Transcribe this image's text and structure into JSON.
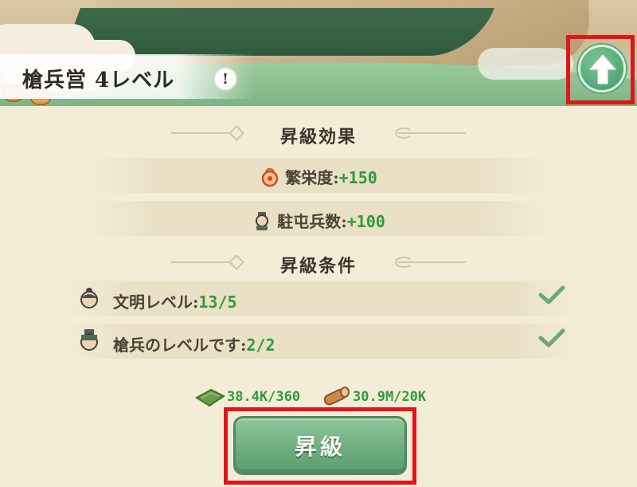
{
  "header": {
    "title": "槍兵営 4レベル",
    "info_glyph": "!"
  },
  "upgrade_badge": {
    "icon": "arrow-up-icon"
  },
  "effects": {
    "title": "昇級効果",
    "items": [
      {
        "icon": "prosperity-icon",
        "label": "繁栄度:",
        "value": "+150"
      },
      {
        "icon": "soldier-icon",
        "label": "駐屯兵数:",
        "value": "+100"
      }
    ]
  },
  "conditions": {
    "title": "昇級条件",
    "items": [
      {
        "icon": "civilization-avatar-icon",
        "label": "文明レベル:",
        "value": "13/5",
        "met": true
      },
      {
        "icon": "spearman-avatar-icon",
        "label": "槍兵のレベルです:",
        "value": "2/2",
        "met": true
      }
    ]
  },
  "costs": [
    {
      "icon": "grass-resource-icon",
      "value": "38.4K/360"
    },
    {
      "icon": "wood-resource-icon",
      "value": "30.9M/20K"
    }
  ],
  "button": {
    "label": "昇級"
  },
  "colors": {
    "accent_green": "#2f9a3f",
    "highlight_red": "#e2141c",
    "button_green": "#6fae80"
  }
}
